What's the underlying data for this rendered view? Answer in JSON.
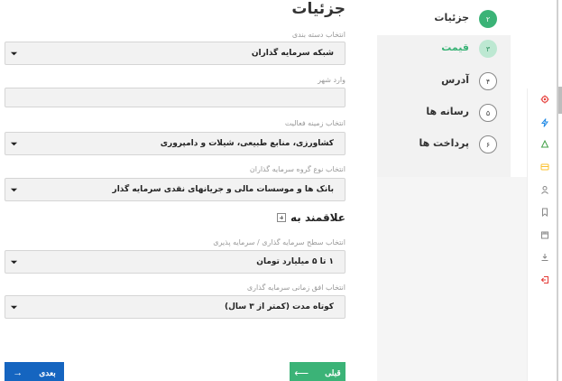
{
  "form": {
    "title": "جزئیات",
    "fields": [
      {
        "label": "انتخاب دسته بندی",
        "value": "شبکه سرمایه گذاران"
      },
      {
        "label": "وارد شهر",
        "value": ""
      },
      {
        "label": "انتخاب زمینه فعالیت",
        "value": "کشاورزی، منابع طبیعی، شیلات و دامپروری"
      },
      {
        "label": "انتخاب نوع گروه سرمایه گذاران",
        "value": "بانک ها و موسسات مالی و جریانهای نقدی سرمایه گذار"
      },
      {
        "label": "انتخاب سطح سرمایه گذاری / سرمایه پذیری",
        "value": "۱ تا ۵ میلیارد تومان"
      },
      {
        "label": "انتخاب افق زمانی سرمایه گذاری",
        "value": "کوتاه مدت (کمتر از ۳ سال)"
      }
    ],
    "section_title": "علاقمند به",
    "next_label": "بعدی",
    "prev_label": "قبلی"
  },
  "steps": [
    {
      "num": "۲",
      "label": "جزئیات",
      "state": "active"
    },
    {
      "num": "۳",
      "label": "قیمت",
      "state": "light"
    },
    {
      "num": "۴",
      "label": "آدرس",
      "state": "outline"
    },
    {
      "num": "۵",
      "label": "رسانه ها",
      "state": "outline"
    },
    {
      "num": "۶",
      "label": "پرداخت ها",
      "state": "outline"
    }
  ],
  "rail_icons": [
    {
      "name": "gear-icon",
      "color": "#e53935"
    },
    {
      "name": "bolt-icon",
      "color": "#1e88e5"
    },
    {
      "name": "bell-icon",
      "color": "#43a047"
    },
    {
      "name": "card-icon",
      "color": "#fbc02d"
    },
    {
      "name": "user-icon",
      "color": "#888888"
    },
    {
      "name": "bookmark-icon",
      "color": "#888888"
    },
    {
      "name": "store-icon",
      "color": "#888888"
    },
    {
      "name": "download-icon",
      "color": "#888888"
    },
    {
      "name": "logout-icon",
      "color": "#e53935"
    }
  ]
}
